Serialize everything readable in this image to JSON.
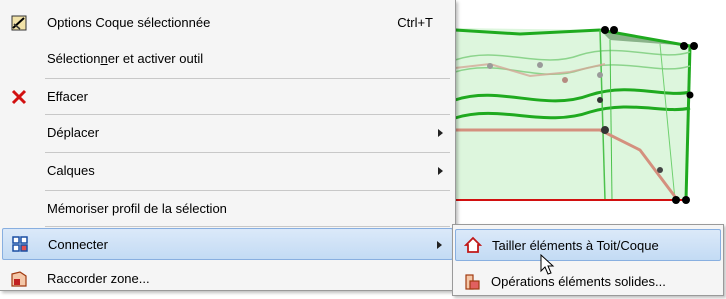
{
  "context_menu": {
    "items": [
      {
        "label": "Options Coque sélectionnée",
        "shortcut": "Ctrl+T",
        "icon": "shell-options-icon"
      },
      {
        "label_before": "Sélection",
        "label_underlined": "n",
        "label_after": "er et activer outil"
      },
      {
        "label": "Effacer",
        "icon": "delete-x-icon"
      },
      {
        "label": "Déplacer",
        "submenu": true
      },
      {
        "label": "Calques",
        "submenu": true
      },
      {
        "label": "Mémoriser profil de la sélection"
      },
      {
        "label": "Connecter",
        "submenu": true,
        "icon": "connect-icon",
        "highlighted": true
      },
      {
        "label": "Raccorder zone...",
        "icon": "join-zone-icon"
      }
    ]
  },
  "submenu": {
    "items": [
      {
        "label": "Tailler éléments à Toit/Coque",
        "icon": "trim-to-roof-icon",
        "highlighted": true
      },
      {
        "label": "Opérations éléments solides...",
        "icon": "solid-operations-icon"
      }
    ]
  },
  "colors": {
    "highlight": "#c3dbf4",
    "shell_fill": "#c8f0c8",
    "shell_edge": "#1faa1f",
    "profile_line": "#d4907e",
    "delete_red": "#d21010"
  }
}
